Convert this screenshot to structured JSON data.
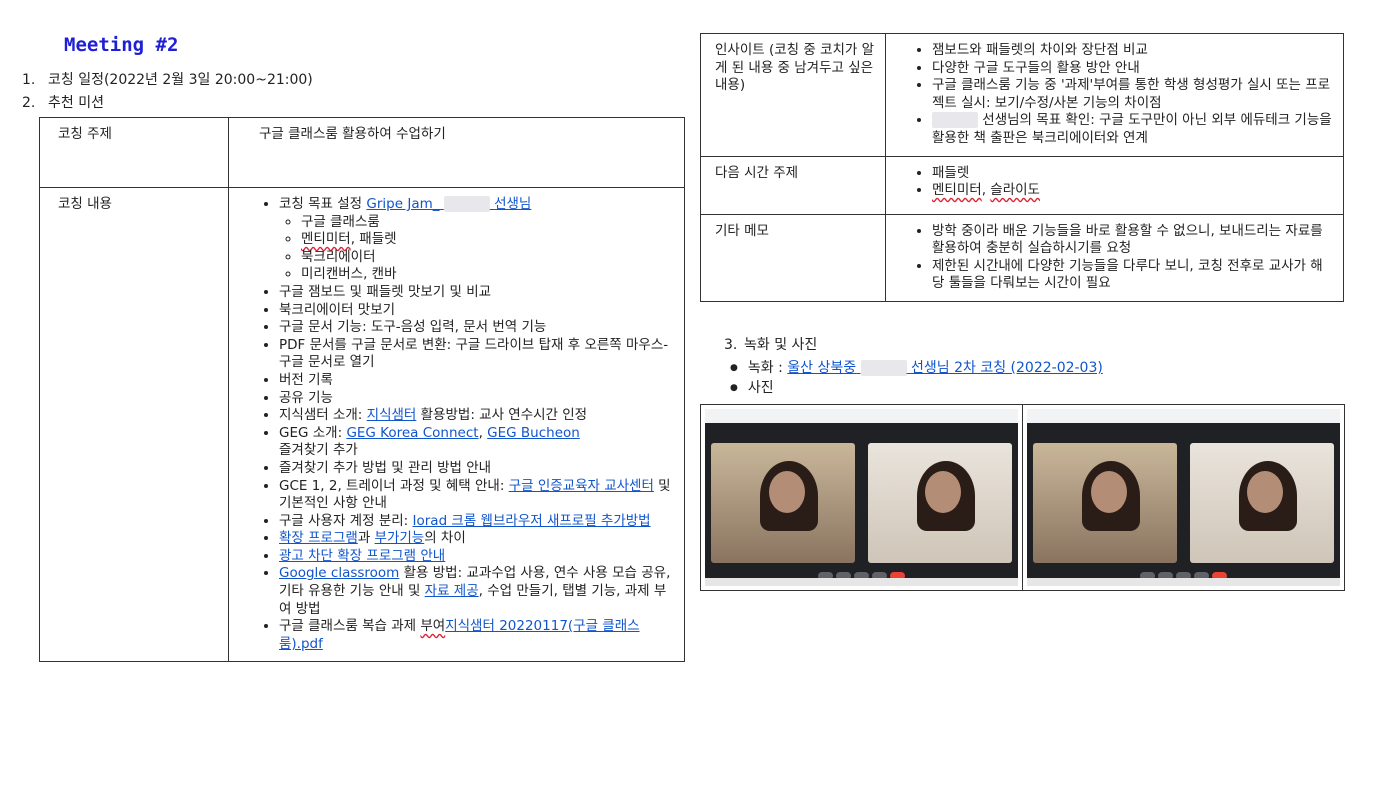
{
  "title": "Meeting #2",
  "section1": {
    "num": "1.",
    "text": "코칭 일정(2022년 2월 3일 20:00~21:00)"
  },
  "section2": {
    "num": "2.",
    "text": "추천 미션"
  },
  "main_table": {
    "topic_label": "코칭 주제",
    "topic_value": "구글 클래스룸 활용하여 수업하기",
    "content_label": "코칭 내용",
    "goal_prefix": "코칭 목표 설정 ",
    "goal_link_a": "Gripe Jam_",
    "goal_link_b": "선생님",
    "goal_subs": [
      "구글 클래스룸",
      "멘티미터",
      ", 패들렛",
      "북크리에이터",
      "미리캔버스, 캔바"
    ],
    "b1": "구글 잼보드 및 패들렛 맛보기 및 비교",
    "b2": "북크리에이터 맛보기",
    "b3": "구글 문서 기능: 도구-음성 입력, 문서 번역 기능",
    "b4": "PDF 문서를 구글 문서로 변환: 구글 드라이브 탑재 후 오른쪽 마우스-구글 문서로 열기",
    "b5": "버전 기록",
    "b6": "공유 기능",
    "b7_pre": "지식샘터 소개: ",
    "b7_link": "지식샘터",
    "b7_post": " 활용방법: 교사 연수시간 인정",
    "b8_pre": "GEG 소개: ",
    "b8_link1": "GEG Korea Connect",
    "b8_sep": ", ",
    "b8_link2": "GEG Bucheon",
    "b8_post": "즐겨찾기 추가",
    "b9": "즐겨찾기 추가 방법 및 관리 방법 안내",
    "b10_pre": "GCE 1, 2, 트레이너 과정 및 혜택 안내: ",
    "b10_link": "구글 인증교육자 교사센터",
    "b10_post": " 및 기본적인 사항 안내",
    "b11_pre": "구글 사용자 계정 분리: ",
    "b11_link": "Iorad 크롬 웹브라우저 새프로필 추가방법",
    "b12_link1": "확장 프로그램",
    "b12_mid": "과 ",
    "b12_link2": "부가기능",
    "b12_post": "의 차이",
    "b13_link": "광고 차단 확장 프로그램 안내",
    "b14_link": "Google classroom",
    "b14_mid": " 활용 방법: 교과수업 사용, 연수 사용 모습 공유, 기타 유용한 기능 안내 및 ",
    "b14_link2": "자료 제공",
    "b14_post": ", 수업 만들기, 탭별 기능, 과제 부여 방법",
    "b15_pre": "구글 클래스룸 복습 과제 ",
    "b15_sq": "부여",
    "b15_link": "지식샘터 20220117(구글 클래스룸).pdf"
  },
  "right_table": {
    "insight_label": "인사이트 (코칭 중 코치가 알게 된 내용 중 남겨두고 싶은 내용)",
    "insights": [
      "잼보드와 패들렛의 차이와 장단점 비교",
      "다양한 구글 도구들의 활용 방안 안내",
      "구글 클래스룸 기능 중 '과제'부여를 통한 학생 형성평가 실시 또는 프로젝트 실시: 보기/수정/사본 기능의 차이점"
    ],
    "insight4": "선생님의 목표 확인: 구글 도구만이 아닌 외부 에듀테크 기능을 활용한 책 출판은 북크리에이터와 연계",
    "next_label": "다음 시간 주제",
    "next_items": [
      "패들렛",
      "멘티미터",
      ", ",
      "슬라이도"
    ],
    "memo_label": "기타 메모",
    "memo_items": [
      "방학 중이라 배운 기능들을 바로 활용할 수 없으니, 보내드리는 자료를 활용하여 충분히 실습하시기를 요청",
      "제한된 시간내에 다양한 기능들을 다루다 보니, 코칭 전후로 교사가 해당 툴들을 다뤄보는 시간이 필요"
    ]
  },
  "section3": {
    "num": "3.",
    "text": "녹화 및 사진",
    "rec_label": "녹화 : ",
    "rec_link_a": "울산 상북중",
    "rec_link_b": "선생님 2차 코칭 (2022-02-03)",
    "photo_label": "사진"
  }
}
